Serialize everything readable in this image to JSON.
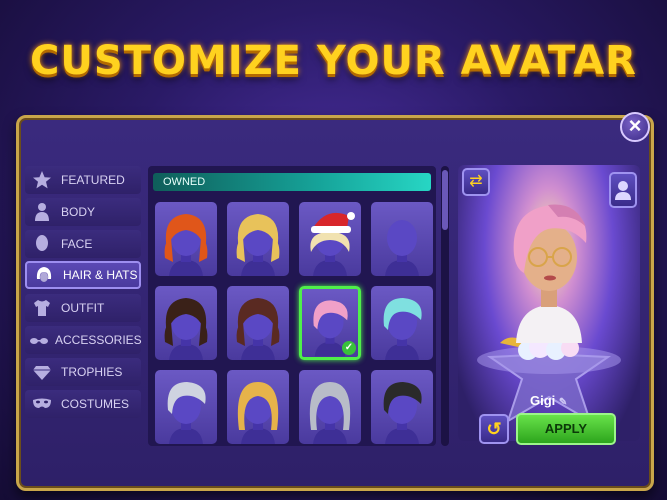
{
  "header": {
    "title": "CUSTOMIZE YOUR AVATAR"
  },
  "categories": [
    {
      "label": "FEATURED",
      "icon": "star-icon"
    },
    {
      "label": "BODY",
      "icon": "body-icon"
    },
    {
      "label": "FACE",
      "icon": "face-icon"
    },
    {
      "label": "HAIR & HATS",
      "icon": "hair-icon",
      "active": true
    },
    {
      "label": "OUTFIT",
      "icon": "shirt-icon"
    },
    {
      "label": "ACCESSORIES",
      "icon": "glasses-icon"
    },
    {
      "label": "TROPHIES",
      "icon": "diamond-icon"
    },
    {
      "label": "COSTUMES",
      "icon": "mask-icon"
    }
  ],
  "grid": {
    "section_label": "OWNED",
    "items": [
      {
        "hair": "#e0561a",
        "style": "curly"
      },
      {
        "hair": "#e8c25a",
        "style": "curly"
      },
      {
        "hair": "#f1e2b0",
        "style": "santa-hat"
      },
      {
        "hair": "none",
        "style": "bald"
      },
      {
        "hair": "#3a2118",
        "style": "curly"
      },
      {
        "hair": "#5a2a22",
        "style": "curly"
      },
      {
        "hair": "#f0a0c8",
        "style": "short",
        "selected": true
      },
      {
        "hair": "#7fe0e0",
        "style": "short"
      },
      {
        "hair": "#cfd3e0",
        "style": "short"
      },
      {
        "hair": "#e6b34a",
        "style": "long"
      },
      {
        "hair": "#b8bcc8",
        "style": "long"
      },
      {
        "hair": "#2a2a2a",
        "style": "short"
      }
    ]
  },
  "preview": {
    "name": "Gigi",
    "apply_label": "APPLY"
  },
  "colors": {
    "accent_gold": "#ffd21f",
    "selected_green": "#4ff04a",
    "owned_teal": "#16a49a"
  }
}
